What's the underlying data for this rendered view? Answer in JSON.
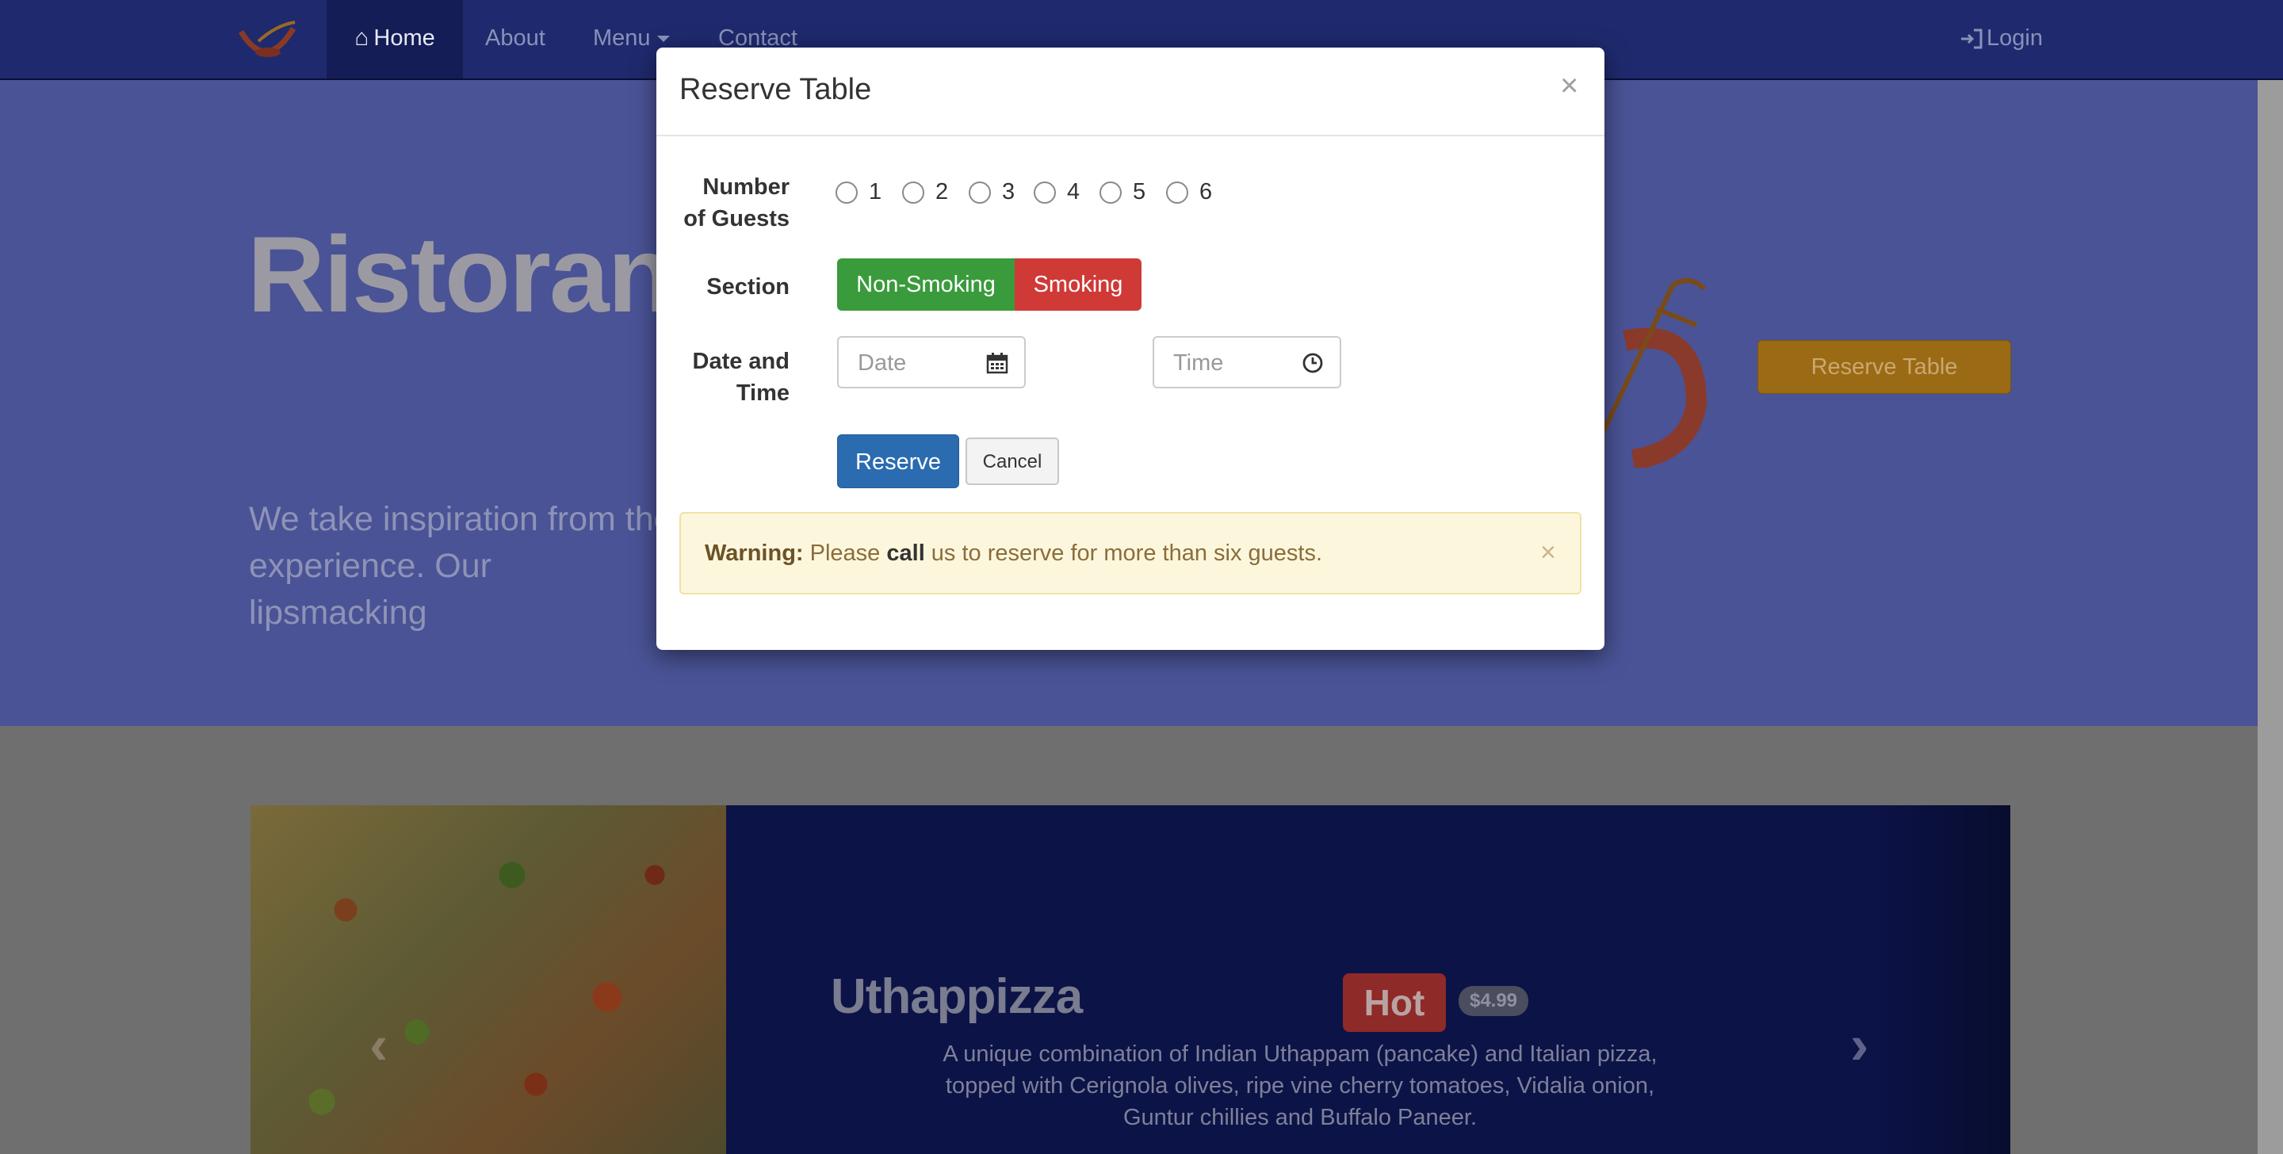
{
  "nav": {
    "home_label": "Home",
    "about_label": "About",
    "menu_label": "Menu",
    "contact_label": "Contact",
    "login_label": "Login"
  },
  "jumbotron": {
    "title": "Ristorant",
    "text": "We take inspiration from the experience. Our lipsmacking",
    "reserve_button": "Reserve Table"
  },
  "carousel": {
    "dish_name": "Uthappizza",
    "badge": "Hot",
    "price": "$4.99",
    "description": "A unique combination of Indian Uthappam (pancake) and Italian pizza, topped with Cerignola olives, ripe vine cherry tomatoes, Vidalia onion, Guntur chillies and Buffalo Paneer."
  },
  "modal": {
    "title": "Reserve Table",
    "close_glyph": "×",
    "guests_label": "Number of Guests",
    "guest_options": [
      "1",
      "2",
      "3",
      "4",
      "5",
      "6"
    ],
    "section_label": "Section",
    "section_options": [
      "Non-Smoking",
      "Smoking"
    ],
    "datetime_label": "Date and Time",
    "date_placeholder": "Date",
    "time_placeholder": "Time",
    "reserve_button": "Reserve",
    "cancel_button": "Cancel",
    "alert": {
      "strong": "Warning:",
      "part1": " Please ",
      "emphasis": "call",
      "part2": " us to reserve for more than six guests.",
      "close_glyph": "×"
    }
  },
  "colors": {
    "navbar": "#1f2a6e",
    "success": "#3a9b3c",
    "danger": "#cf3a36",
    "primary": "#2b6bb0",
    "warning_bg": "#fcf7dc"
  },
  "icons": [
    "home-icon",
    "login-icon",
    "calendar-icon",
    "clock-icon",
    "close-icon",
    "chevron-left-icon",
    "chevron-right-icon"
  ]
}
